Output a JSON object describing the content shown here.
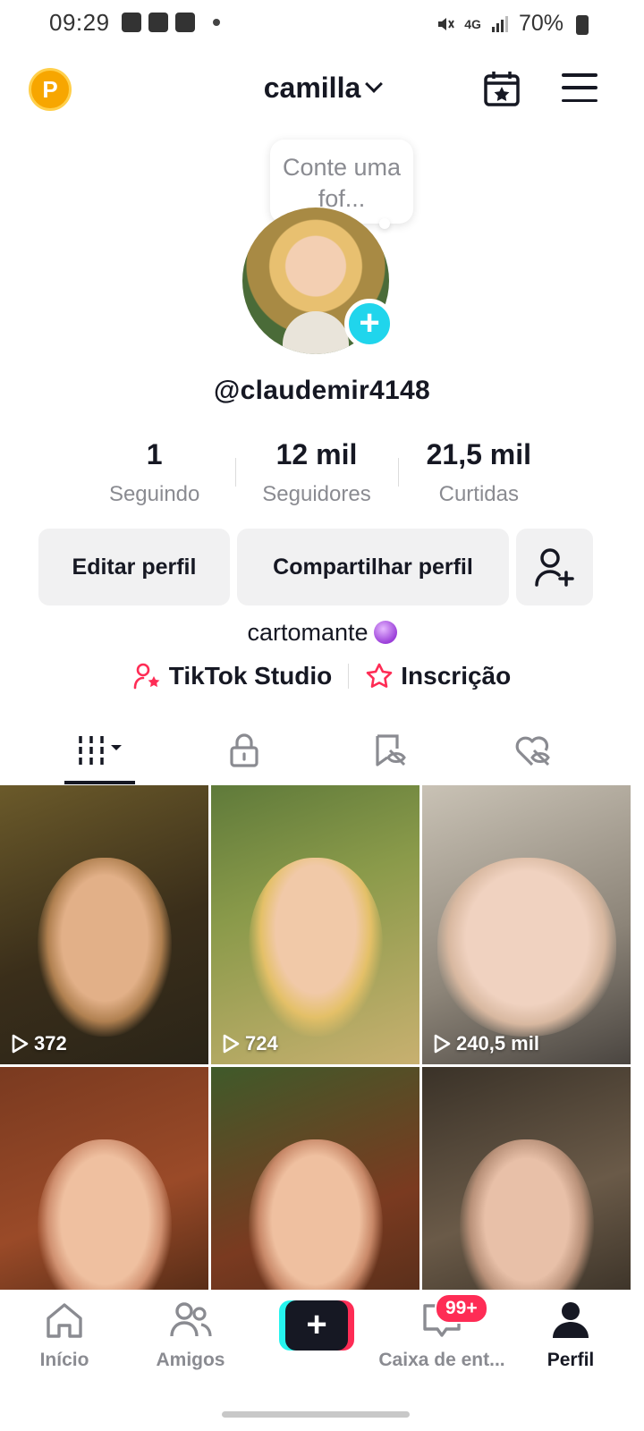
{
  "status_bar": {
    "time": "09:29",
    "battery": "70%",
    "network": "4G"
  },
  "header": {
    "coin_letter": "P",
    "account_name": "camilla"
  },
  "profile": {
    "note_bubble": "Conte uma fof...",
    "handle": "@claudemir4148",
    "stats": [
      {
        "value": "1",
        "label": "Seguindo"
      },
      {
        "value": "12 mil",
        "label": "Seguidores"
      },
      {
        "value": "21,5 mil",
        "label": "Curtidas"
      }
    ],
    "buttons": {
      "edit": "Editar perfil",
      "share": "Compartilhar perfil"
    },
    "bio": "cartomante",
    "links": {
      "studio": "TikTok Studio",
      "subscription": "Inscrição"
    }
  },
  "videos": [
    {
      "views": "372"
    },
    {
      "views": "724"
    },
    {
      "views": "240,5 mil"
    },
    {
      "views": ""
    },
    {
      "views": ""
    },
    {
      "views": ""
    }
  ],
  "bottom_nav": {
    "home": "Início",
    "friends": "Amigos",
    "inbox": "Caixa de ent...",
    "inbox_badge": "99+",
    "profile": "Perfil"
  },
  "colors": {
    "accent_cyan": "#25f4ee",
    "accent_red": "#fe2c55",
    "add_avatar": "#20d5ec",
    "coin": "#f7a600"
  }
}
